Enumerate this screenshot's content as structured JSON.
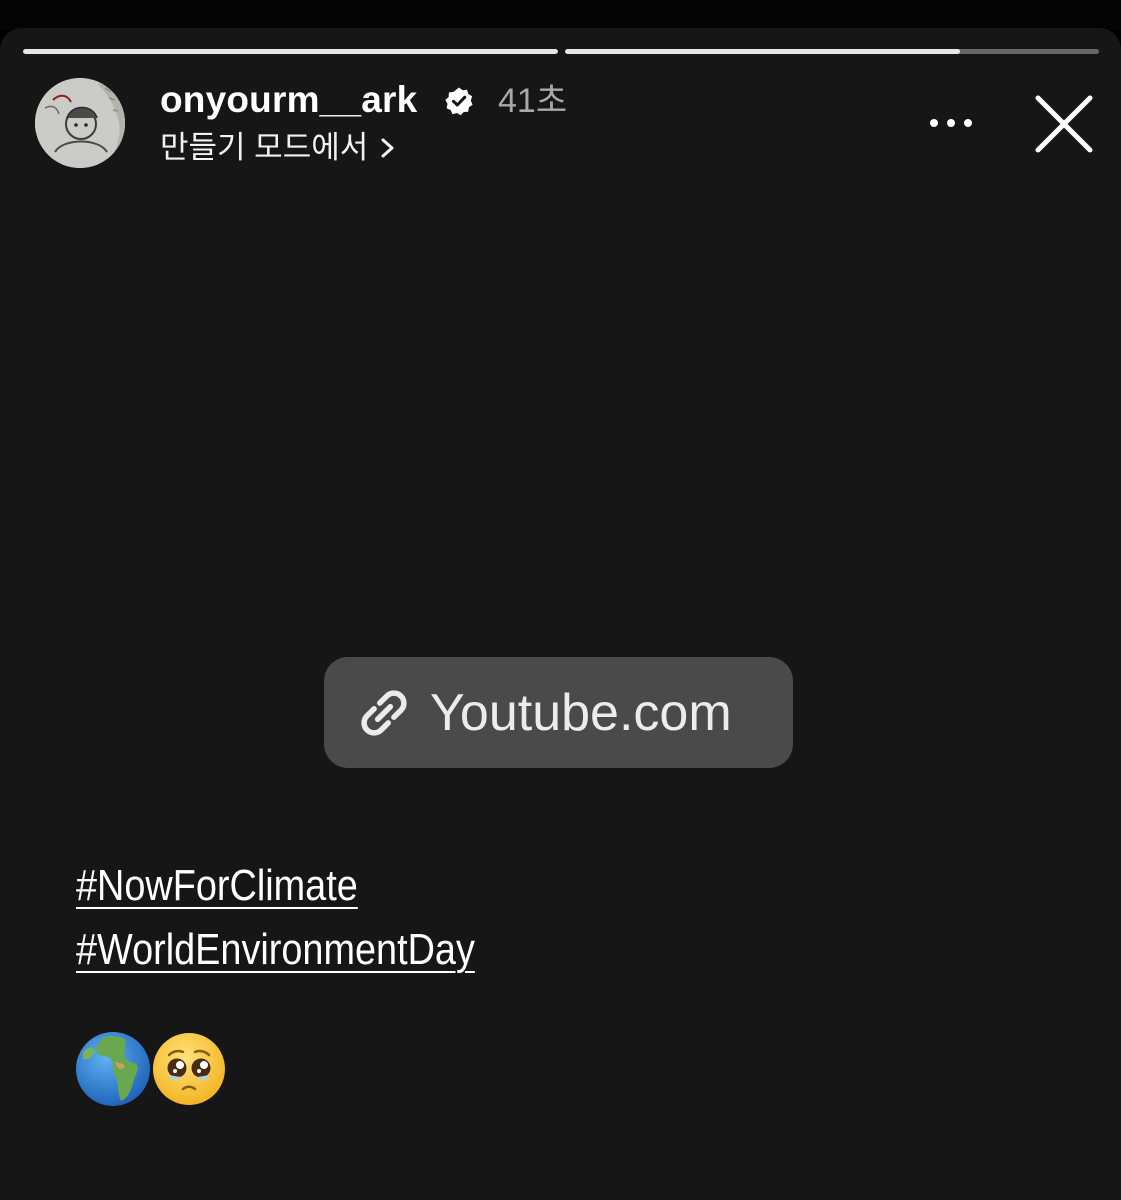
{
  "story": {
    "progress": [
      1.0,
      0.74
    ]
  },
  "header": {
    "username": "onyourm__ark",
    "timestamp": "41초",
    "subtitle": "만들기 모드에서",
    "verified": true
  },
  "icons": {
    "verified": "verified-badge-icon",
    "chevron": "chevron-right-icon",
    "more": "more-options-icon",
    "close": "close-icon",
    "link": "link-icon"
  },
  "link_sticker": {
    "label": "Youtube.com"
  },
  "hashtags": [
    "#NowForClimate",
    "#WorldEnvironmentDay"
  ],
  "emojis": [
    "🌍",
    "🥹"
  ],
  "colors": {
    "background": "#161616",
    "sticker": "#4a4a4a",
    "timestamp": "#a9a9a9",
    "progress_fill": "#e6e6e6"
  }
}
